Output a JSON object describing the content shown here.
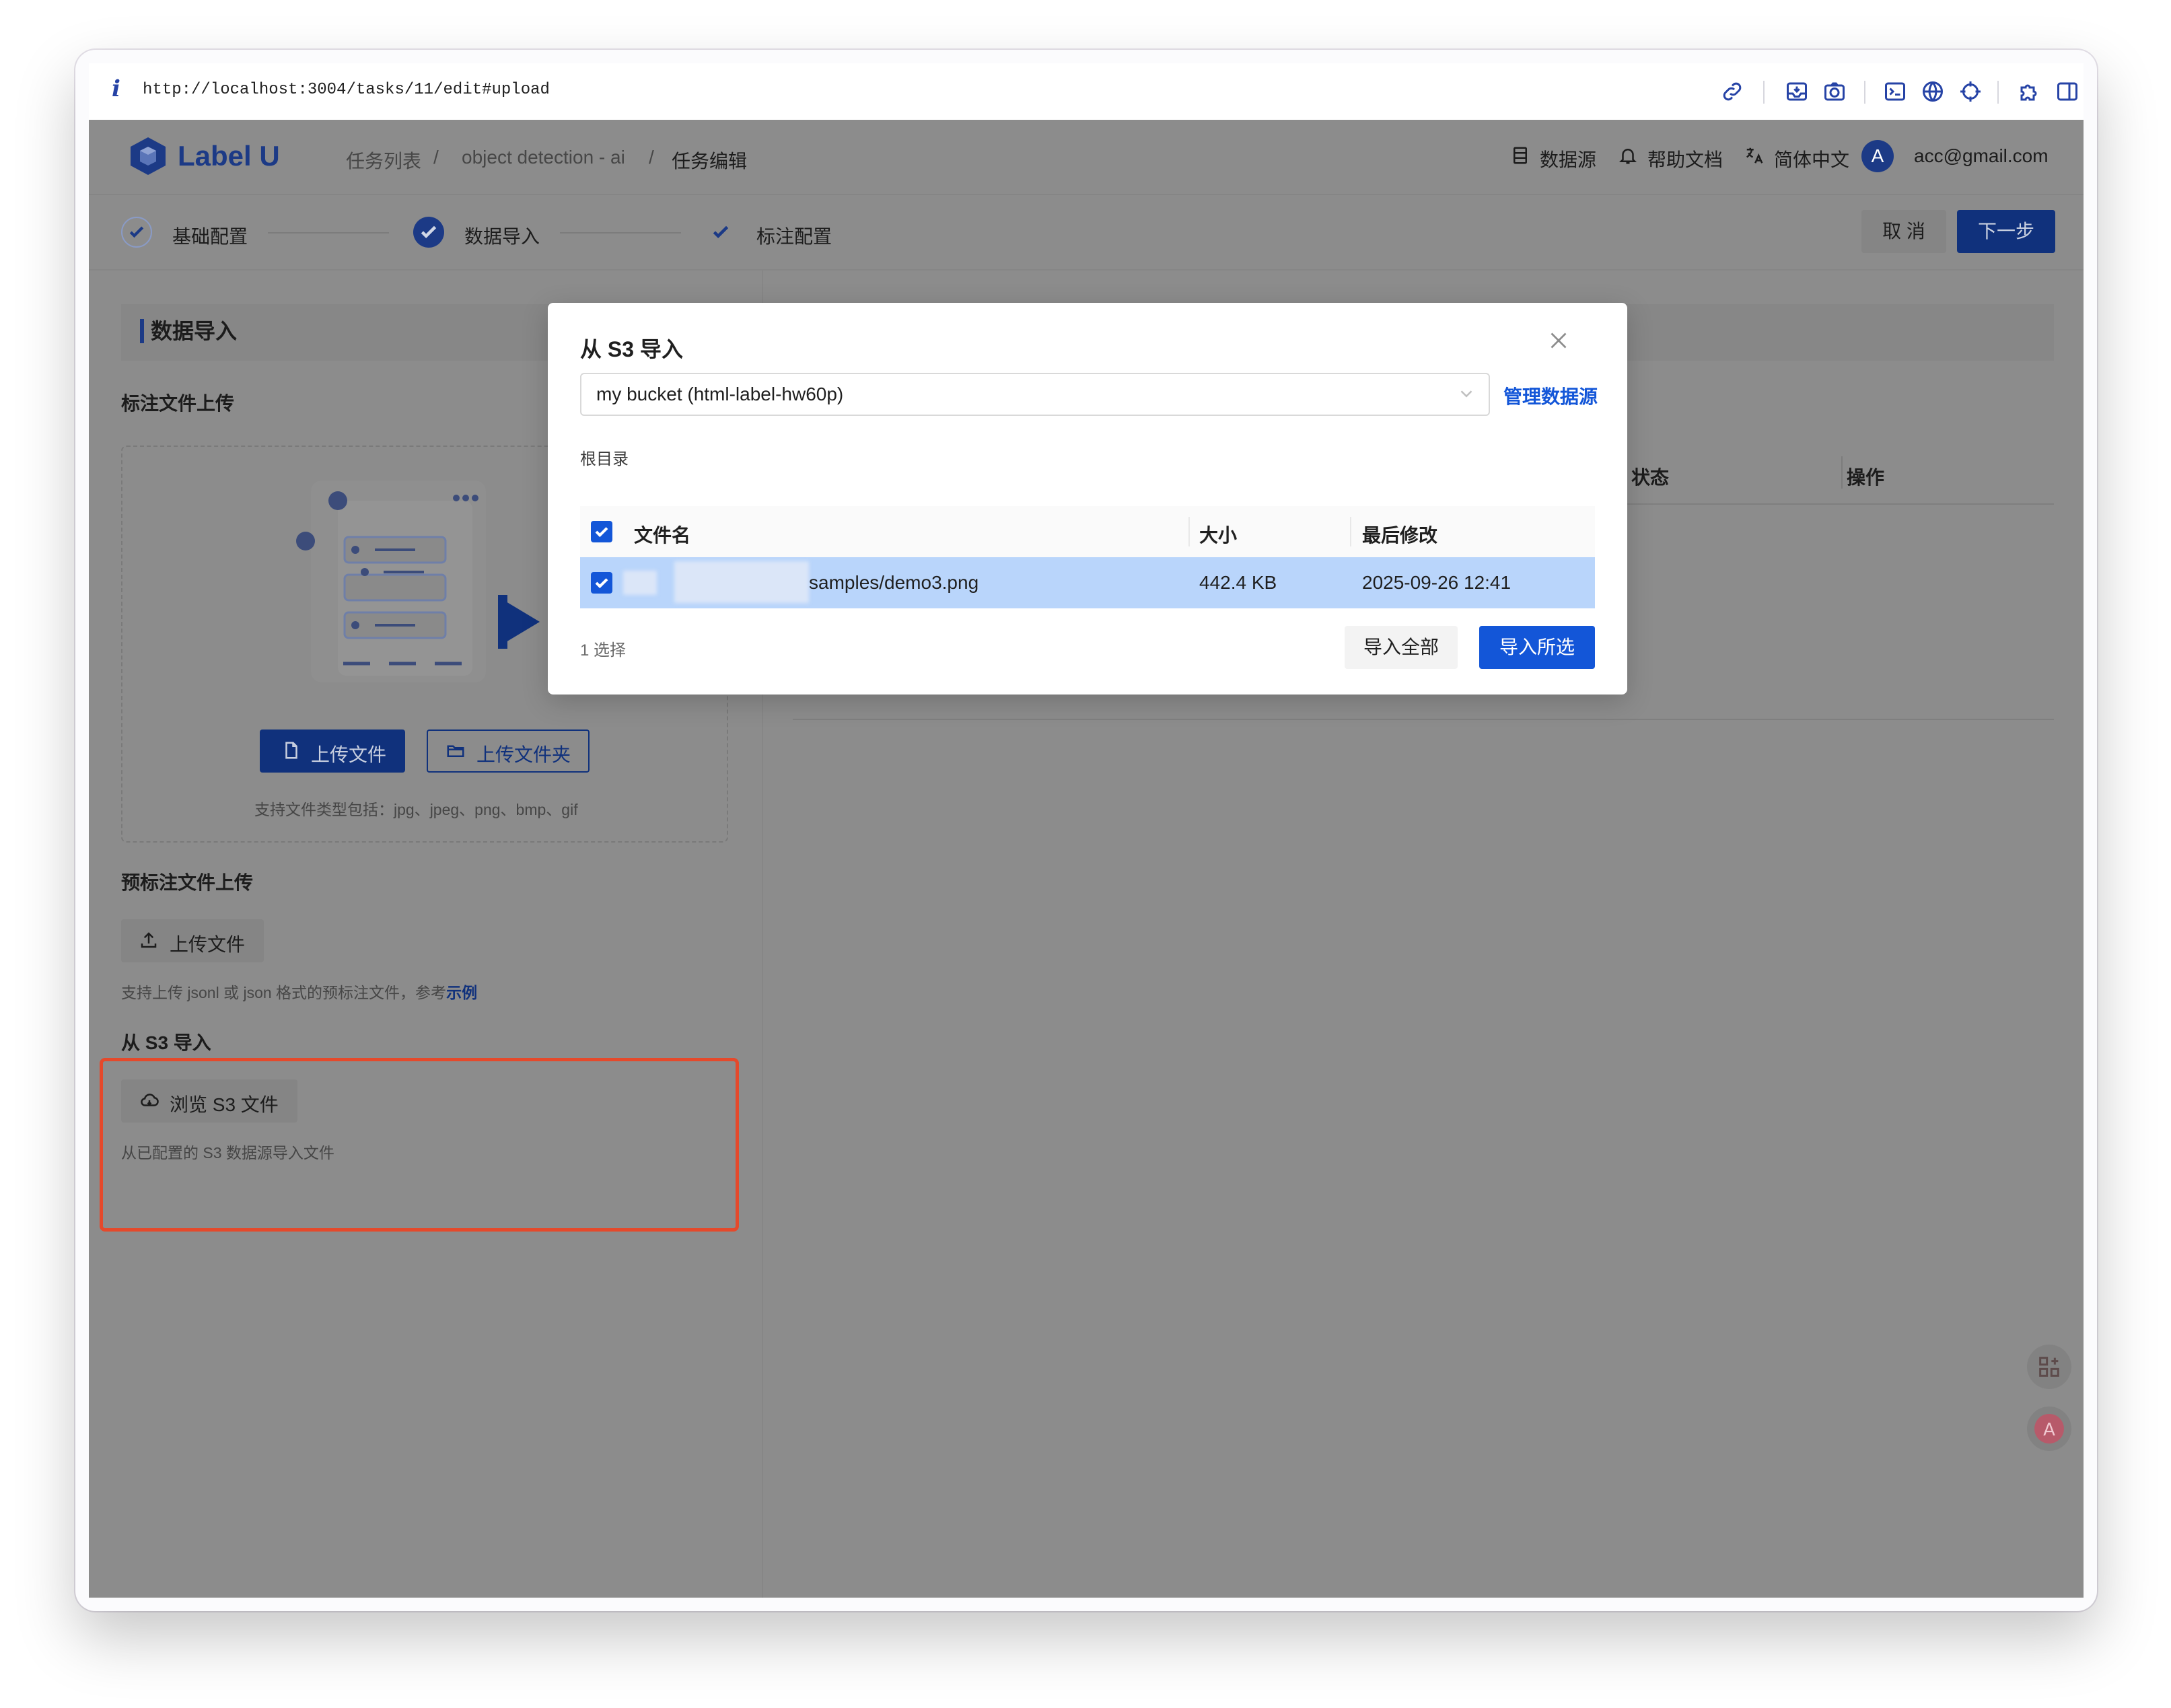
{
  "browser": {
    "url": "http://localhost:3004/tasks/11/edit#upload",
    "info_glyph": "i",
    "toolbar_icons": [
      "link-icon",
      "inbox-icon",
      "camera-icon",
      "terminal-icon",
      "globe-icon",
      "crosshair-icon",
      "puzzle-icon",
      "sidebar-icon"
    ]
  },
  "header": {
    "logo": "Label U",
    "breadcrumb": [
      "任务列表",
      "object detection - ai",
      "任务编辑"
    ],
    "breadcrumb_sep": "/",
    "datasource": "数据源",
    "help": "帮助文档",
    "language": "简体中文",
    "avatar_letter": "A",
    "user": "acc@gmail.com"
  },
  "steps": {
    "items": [
      "基础配置",
      "数据导入",
      "标注配置"
    ],
    "cancel": "取 消",
    "next": "下一步"
  },
  "main": {
    "section_title": "数据导入",
    "annotation_upload": {
      "title": "标注文件上传",
      "upload_file": "上传文件",
      "upload_folder": "上传文件夹",
      "hint": "支持文件类型包括：jpg、jpeg、png、bmp、gif"
    },
    "pre_annotation": {
      "title": "预标注文件上传",
      "upload_file": "上传文件",
      "hint": "支持上传 jsonl 或 json 格式的预标注文件，参考",
      "hint_link": "示例"
    },
    "s3_import": {
      "title": "从 S3 导入",
      "browse": "浏览 S3 文件",
      "hint": "从已配置的 S3 数据源导入文件"
    },
    "table_headers": {
      "status": "状态",
      "action": "操作"
    }
  },
  "modal": {
    "title": "从 S3 导入",
    "bucket": "my bucket (html-label-hw60p)",
    "manage": "管理数据源",
    "root": "根目录",
    "columns": {
      "name": "文件名",
      "size": "大小",
      "modified": "最后修改"
    },
    "rows": [
      {
        "name": "samples/demo3.png",
        "size": "442.4 KB",
        "modified": "2025-09-26 12:41"
      }
    ],
    "selected_count": "1 选择",
    "import_all": "导入全部",
    "import_selected": "导入所选"
  },
  "colors": {
    "brand": "#1c3a86",
    "primary": "#1356d8",
    "highlight": "#e5492b",
    "row_selected": "#b9d5fb"
  }
}
